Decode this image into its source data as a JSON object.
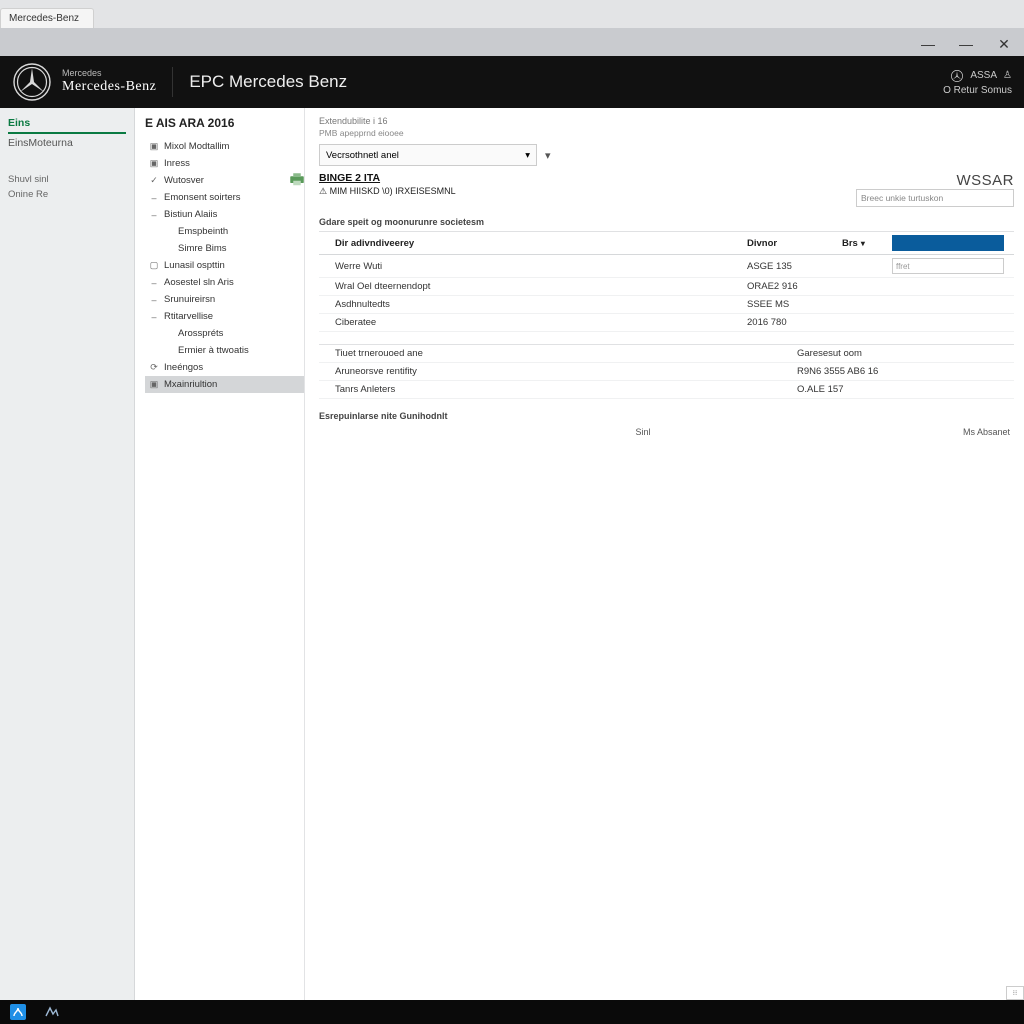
{
  "tab": {
    "label": "Mercedes-Benz"
  },
  "window": {
    "min": "—",
    "max": "—",
    "close": "✕"
  },
  "header": {
    "brand_small": "Mercedes",
    "brand_main": "Mercedes-Benz",
    "app_title": "EPC Mercedes Benz",
    "right_label": "ASSA",
    "right_sub": "O Retur Somus"
  },
  "left": {
    "tab_active": "Eins",
    "tab_other": "EinsMoteurna",
    "link1": "Shuvl sinl",
    "link2": "Onine Re"
  },
  "mid": {
    "title": "E AIS ARA 2016",
    "items": [
      {
        "icon": "▣",
        "label": "Mixol Modtallim"
      },
      {
        "icon": "▣",
        "label": "Inress"
      },
      {
        "icon": "✓",
        "label": "Wutosver"
      },
      {
        "icon": "–",
        "label": "Emonsent soirters"
      },
      {
        "icon": "–",
        "label": "Bistiun Alaiis"
      },
      {
        "icon": "",
        "label": "Emspbeinth",
        "sub": true
      },
      {
        "icon": "",
        "label": "Simre Bims",
        "sub": true
      },
      {
        "icon": "▢",
        "label": "Lunasil ospttin"
      },
      {
        "icon": "–",
        "label": "Aosestel sln Aris"
      },
      {
        "icon": "–",
        "label": "Srunuireirsn"
      },
      {
        "icon": "–",
        "label": "Rtitarvellise"
      },
      {
        "icon": "",
        "label": "Arosspréts",
        "sub": true
      },
      {
        "icon": "",
        "label": "Ermier à ttwoatis",
        "sub": true
      },
      {
        "icon": "⟳",
        "label": "Ineéngos"
      },
      {
        "icon": "▣",
        "label": "Mxainriultion",
        "sel": true
      }
    ]
  },
  "main": {
    "crumb1": "Extendubilite i 16",
    "crumb2": "PMB  apepprnd eiooee",
    "dd_label": "Vecrsothnetl anel",
    "doc_title": "BINGE 2 ITA",
    "doc_sub": "⚠  MIM HIISKD \\0) IRXEISESMNL",
    "wsar": "WSSAR",
    "search_placeholder": "Breec unkie turtuskon",
    "section1_title": "Gdare speit og moonurunre societesm",
    "tbl1_header": {
      "c1": "Dir adivndiveerey",
      "c2": "Divnor",
      "c3": "Brs"
    },
    "tbl1_rows": [
      {
        "c1": "Werre Wuti",
        "c2": "ASGE 135",
        "mini": "ffret"
      },
      {
        "c1": "Wral Oel dteernendopt",
        "c2": "ORAE2 916"
      },
      {
        "c1": "Asdhnultedts",
        "c2": "SSEE MS"
      },
      {
        "c1": "Ciberatee",
        "c2": "2016 780"
      }
    ],
    "tbl2_rows": [
      {
        "c1": "Tiuet trnerouoed ane",
        "c2": "Garesesut oom"
      },
      {
        "c1": "Aruneorsve rentifity",
        "c2": "R9N6 3555 AB6 16"
      },
      {
        "c1": "Tanrs Anleters",
        "c2": "O.ALE 157"
      }
    ],
    "section2_title": "Esrepuinlarse nite Gunihodnlt",
    "sinl": "Sinl",
    "footer_right": "Ms Absanet"
  }
}
